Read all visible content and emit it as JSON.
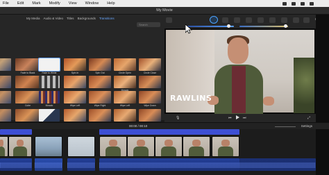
{
  "menubar": {
    "items": [
      "File",
      "Edit",
      "Mark",
      "Modify",
      "View",
      "Window",
      "Help"
    ]
  },
  "window": {
    "title": "My Movie"
  },
  "browser": {
    "tabs": [
      "My Media",
      "Audio & Video",
      "Titles",
      "Backgrounds",
      "Transitions"
    ],
    "active_tab": "Transitions",
    "search_placeholder": "Search",
    "transitions": [
      [
        "",
        "Fade to Black",
        "Fade to White",
        "Spin In",
        "Spin Out",
        "Circle Open",
        "Circle Close"
      ],
      [
        "",
        "",
        "",
        "",
        "",
        "Mosaic",
        ""
      ],
      [
        "",
        "Cube",
        "Mosaic",
        "Wipe Left",
        "Wipe Right",
        "Wipe Left",
        "Wipe Down"
      ],
      [
        "",
        "",
        "",
        "",
        "",
        "",
        ""
      ],
      [
        "",
        "",
        "",
        "",
        "",
        "",
        ""
      ],
      [
        "",
        "Puzzle Left",
        "Puzzle Right",
        "Page Curl Left",
        "Page Curl Right",
        "Cross Zoom",
        ""
      ]
    ]
  },
  "toolbar": {
    "reset_all": "Reset All"
  },
  "viewer": {
    "lower_third": "RAWLINS"
  },
  "timeline": {
    "timecode": "00:00 / 00:10",
    "settings": "Settings"
  },
  "colors": {
    "accent": "#6aa8ff",
    "clip_bar": "#3d4fd3",
    "audio": "#233f9a"
  }
}
